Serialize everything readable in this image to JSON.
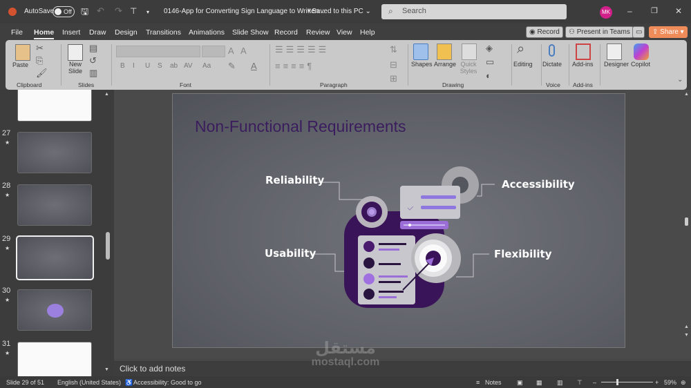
{
  "titlebar": {
    "app_icon": "powerpoint-icon",
    "autosave_label": "AutoSave",
    "autosave_state": "Off",
    "doc_title": "0146-App for Converting Sign Language to Written...",
    "save_status": "• Saved to this PC ⌄",
    "search_placeholder": "Search",
    "avatar_initials": "MK"
  },
  "menu": {
    "tabs": [
      "File",
      "Home",
      "Insert",
      "Draw",
      "Design",
      "Transitions",
      "Animations",
      "Slide Show",
      "Record",
      "Review",
      "View",
      "Help"
    ],
    "active": "Home",
    "record_btn": "Record",
    "teams_btn": "Present in Teams",
    "share_btn": "Share"
  },
  "ribbon": {
    "clipboard": {
      "paste": "Paste",
      "group": "Clipboard"
    },
    "slides": {
      "new_slide": "New Slide",
      "group": "Slides"
    },
    "font": {
      "group": "Font",
      "buttons": [
        "B",
        "I",
        "U",
        "S",
        "ab",
        "AV",
        "Aa",
        "A"
      ]
    },
    "paragraph": {
      "group": "Paragraph"
    },
    "drawing": {
      "shapes": "Shapes",
      "arrange": "Arrange",
      "quick_styles": "Quick Styles",
      "group": "Drawing"
    },
    "editing": {
      "label": "Editing"
    },
    "voice": {
      "dictate": "Dictate",
      "group": "Voice"
    },
    "addins": {
      "label": "Add-ins",
      "group": "Add-ins"
    },
    "designer": "Designer",
    "copilot": "Copilot"
  },
  "thumbnails": [
    {
      "num": "27"
    },
    {
      "num": "28"
    },
    {
      "num": "29"
    },
    {
      "num": "30"
    },
    {
      "num": "31"
    }
  ],
  "slide": {
    "title": "Non-Functional Requirements",
    "labels": {
      "reliability": "Reliability",
      "accessibility": "Accessibility",
      "usability": "Usability",
      "flexibility": "Flexibility"
    },
    "colors": {
      "title": "#3b1d5e",
      "dark_purple": "#3a1458",
      "purple": "#9b6dd6",
      "light_card": "#c9c7ce"
    }
  },
  "notes": {
    "placeholder": "Click to add notes"
  },
  "status": {
    "slide": "Slide 29 of 51",
    "language": "English (United States)",
    "accessibility": "Accessibility: Good to go",
    "notes": "Notes",
    "zoom": "59%",
    "zoom_fraction": 0.59
  },
  "watermark": {
    "arabic": "مستقل",
    "latin": "mostaql.com"
  }
}
